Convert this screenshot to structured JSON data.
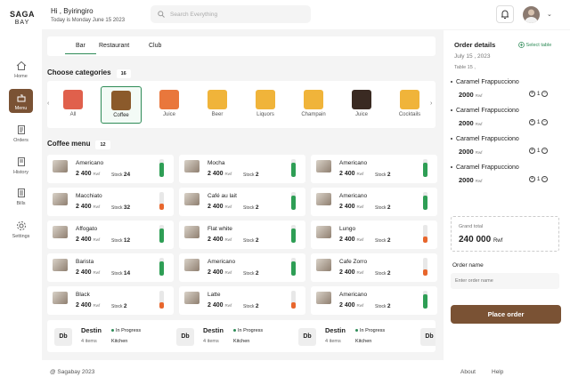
{
  "brand": {
    "line1": "SAGA",
    "line2": "BAY"
  },
  "nav": [
    {
      "label": "Home",
      "icon": "home-icon"
    },
    {
      "label": "Menu",
      "icon": "menu-icon"
    },
    {
      "label": "Orders",
      "icon": "orders-icon"
    },
    {
      "label": "History",
      "icon": "history-icon"
    },
    {
      "label": "Bills",
      "icon": "bills-icon"
    },
    {
      "label": "Settings",
      "icon": "settings-icon"
    }
  ],
  "header": {
    "greeting": "Hi , Byiringiro",
    "date_line": "Today is Monday June 15 2023",
    "search_placeholder": "Search Everything"
  },
  "tabs": [
    "Bar",
    "Restaurant",
    "Club"
  ],
  "categories": {
    "title": "Choose categories",
    "count": "16",
    "items": [
      {
        "label": "All",
        "color": "#e0604c"
      },
      {
        "label": "Coffee",
        "color": "#8b5a2b"
      },
      {
        "label": "Juice",
        "color": "#e9773c"
      },
      {
        "label": "Beer",
        "color": "#f0b43a"
      },
      {
        "label": "Liquors",
        "color": "#f0b43a"
      },
      {
        "label": "Champain",
        "color": "#f0b43a"
      },
      {
        "label": "Juice",
        "color": "#3a2a22"
      },
      {
        "label": "Cocktails",
        "color": "#f0b43a"
      }
    ]
  },
  "menu": {
    "title": "Coffee menu",
    "count": "12",
    "price_unit": "Rwf",
    "stock_label": "Stock",
    "items": [
      {
        "name": "Americano",
        "price": "2 400",
        "stock": "24",
        "level": 0.8,
        "color": "#2e9e55"
      },
      {
        "name": "Mocha",
        "price": "2 400",
        "stock": "2",
        "level": 0.8,
        "color": "#2e9e55"
      },
      {
        "name": "Americano",
        "price": "2 400",
        "stock": "2",
        "level": 0.8,
        "color": "#2e9e55"
      },
      {
        "name": "Macchiato",
        "price": "2 400",
        "stock": "32",
        "level": 0.35,
        "color": "#e8662c"
      },
      {
        "name": "Café au lait",
        "price": "2 400",
        "stock": "2",
        "level": 0.8,
        "color": "#2e9e55"
      },
      {
        "name": "Americano",
        "price": "2 400",
        "stock": "2",
        "level": 0.8,
        "color": "#2e9e55"
      },
      {
        "name": "Affogato",
        "price": "2 400",
        "stock": "12",
        "level": 0.8,
        "color": "#2e9e55"
      },
      {
        "name": "Flat white",
        "price": "2 400",
        "stock": "2",
        "level": 0.8,
        "color": "#2e9e55"
      },
      {
        "name": "Lungo",
        "price": "2 400",
        "stock": "2",
        "level": 0.35,
        "color": "#e8662c"
      },
      {
        "name": "Barista",
        "price": "2 400",
        "stock": "14",
        "level": 0.8,
        "color": "#2e9e55"
      },
      {
        "name": "Americano",
        "price": "2 400",
        "stock": "2",
        "level": 0.8,
        "color": "#2e9e55"
      },
      {
        "name": "Cafe Zorro",
        "price": "2 400",
        "stock": "2",
        "level": 0.35,
        "color": "#e8662c"
      },
      {
        "name": "Black",
        "price": "2 400",
        "stock": "2",
        "level": 0.35,
        "color": "#e8662c"
      },
      {
        "name": "Latte",
        "price": "2 400",
        "stock": "2",
        "level": 0.35,
        "color": "#e8662c"
      },
      {
        "name": "Americano",
        "price": "2 400",
        "stock": "2",
        "level": 0.8,
        "color": "#2e9e55"
      }
    ]
  },
  "active_orders": [
    {
      "badge": "Db",
      "name": "Destin",
      "items": "4 items",
      "status": "In Progress",
      "location": "Kitchen"
    },
    {
      "badge": "Db",
      "name": "Destin",
      "items": "4 items",
      "status": "In Progress",
      "location": "Kitchen"
    },
    {
      "badge": "Db",
      "name": "Destin",
      "items": "4 items",
      "status": "In Progress",
      "location": "Kitchen"
    },
    {
      "badge": "Db",
      "name": "D",
      "items": "4 it",
      "status": "",
      "location": ""
    }
  ],
  "footer": {
    "copyright": "@ Sagabay 2023",
    "about": "About",
    "help": "Help"
  },
  "order": {
    "title": "Order details",
    "select_table": "Select table",
    "date": "July  15  , 2023",
    "table": "Table  15  ,",
    "price_unit": "Rwf",
    "lines": [
      {
        "name": "Caramel Frappucciono",
        "price": "2000",
        "qty": "1"
      },
      {
        "name": "Caramel Frappucciono",
        "price": "2000",
        "qty": "1"
      },
      {
        "name": "Caramel Frappucciono",
        "price": "2000",
        "qty": "1"
      },
      {
        "name": "Caramel Frappucciono",
        "price": "2000",
        "qty": "1"
      }
    ],
    "grand_total_label": "Grand total",
    "grand_total": "240 000",
    "grand_unit": "Rwf",
    "name_label": "Order name",
    "name_placeholder": "Enter order name",
    "place_label": "Place order"
  },
  "colors": {
    "accent": "#7a5234",
    "green": "#2e8b57",
    "orange": "#e8662c"
  }
}
